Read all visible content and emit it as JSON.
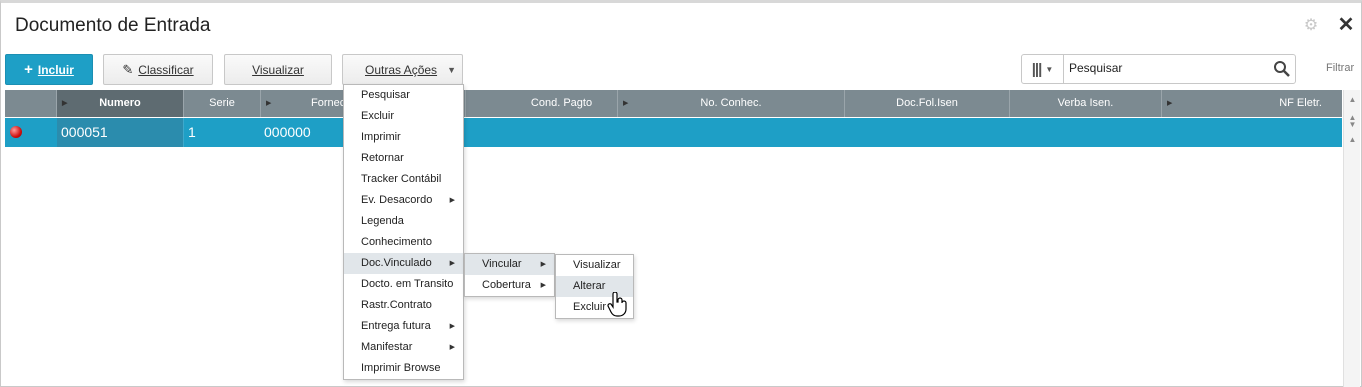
{
  "window": {
    "title": "Documento de Entrada"
  },
  "toolbar": {
    "incluir": "Incluir",
    "classificar": "Classificar",
    "visualizar": "Visualizar",
    "outras_acoes": "Outras Ações"
  },
  "search": {
    "value": "Pesquisar",
    "filtrar": "Filtrar"
  },
  "grid": {
    "columns": [
      "",
      "Numero",
      "Serie",
      "Fornec",
      "Cond. Pagto",
      "No. Conhec.",
      "Doc.Fol.Isen",
      "Verba Isen.",
      "NF Eletr."
    ],
    "rows": [
      {
        "status": "red",
        "numero": "000051",
        "serie": "1",
        "fornec": "000000"
      }
    ]
  },
  "menus": {
    "outras_acoes": [
      "Pesquisar",
      "Excluir",
      "Imprimir",
      "Retornar",
      "Tracker Contábil",
      "Ev. Desacordo",
      "Legenda",
      "Conhecimento",
      "Doc.Vinculado",
      "Docto. em Transito",
      "Rastr.Contrato",
      "Entrega futura",
      "Manifestar",
      "Imprimir Browse"
    ],
    "doc_vinculado": [
      "Vincular",
      "Cobertura"
    ],
    "vincular": [
      "Visualizar",
      "Alterar",
      "Excluir"
    ]
  },
  "colors": {
    "accent": "#1e9fc6",
    "header": "#7c8a91",
    "status_red": "#d01010"
  },
  "icons": [
    "plus-icon",
    "pencil-icon",
    "gear-icon",
    "close-icon",
    "columns-icon",
    "search-icon",
    "hand-cursor-icon"
  ]
}
